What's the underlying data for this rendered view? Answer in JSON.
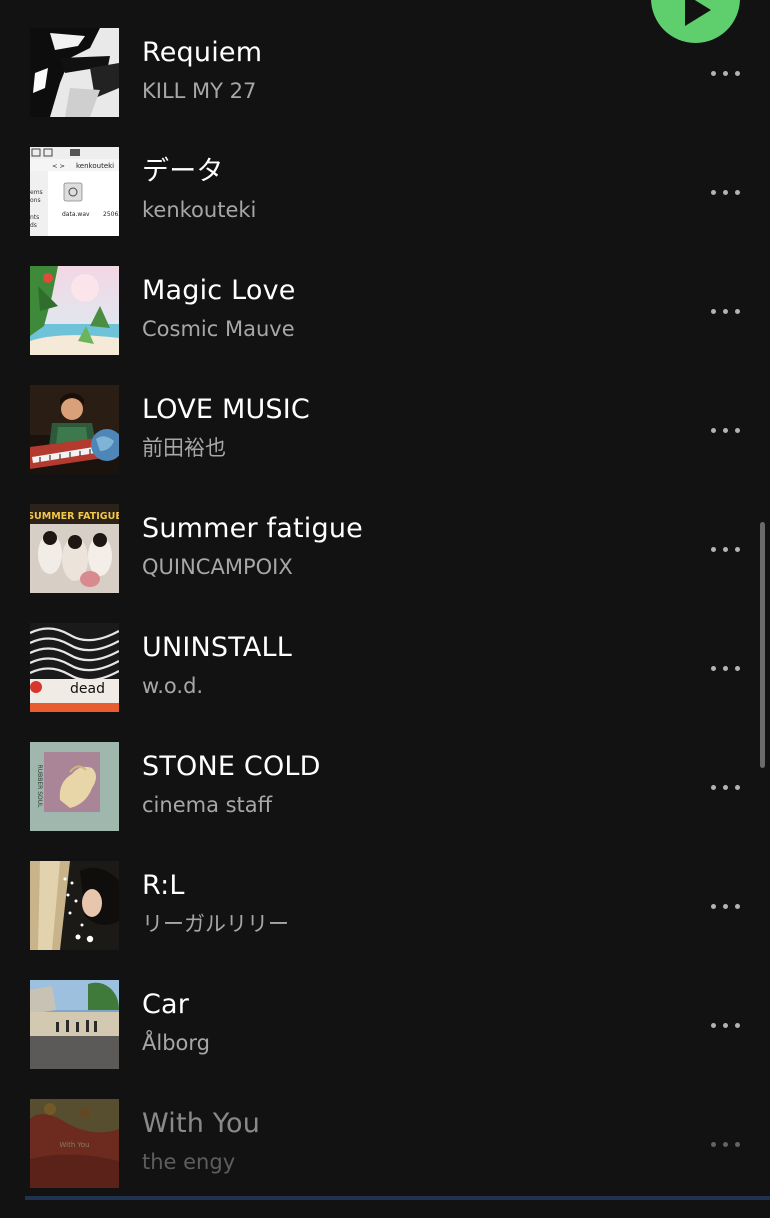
{
  "tracks": [
    {
      "title": "Requiem",
      "artist": "KILL MY 27"
    },
    {
      "title": "データ",
      "artist": "kenkouteki"
    },
    {
      "title": "Magic Love",
      "artist": "Cosmic Mauve"
    },
    {
      "title": "LOVE MUSIC",
      "artist": "前田裕也"
    },
    {
      "title": "Summer fatigue",
      "artist": "QUINCAMPOIX"
    },
    {
      "title": "UNINSTALL",
      "artist": "w.o.d."
    },
    {
      "title": "STONE COLD",
      "artist": "cinema staff"
    },
    {
      "title": "R:L",
      "artist": "リーガルリリー"
    },
    {
      "title": "Car",
      "artist": "Ålborg"
    },
    {
      "title": "With You",
      "artist": "the engy"
    }
  ],
  "cover_art_text": {
    "data_window": {
      "folder": "kenkouteki",
      "file": "data.wav",
      "size": "25062",
      "sidebar_1": "ems",
      "sidebar_2": "ons",
      "sidebar_3": "nts",
      "sidebar_4": "ds"
    },
    "summer": "SUMMER FATIGUE",
    "uninstall": "dead",
    "stone_cold": "RUBBER SOUL",
    "with_you": "With You"
  },
  "icons": {
    "more": "more-horizontal-icon",
    "play": "play-icon"
  },
  "colors": {
    "background": "#121212",
    "title": "#ffffff",
    "subtitle": "#a7a7a7",
    "accent": "#5fcf6e"
  }
}
